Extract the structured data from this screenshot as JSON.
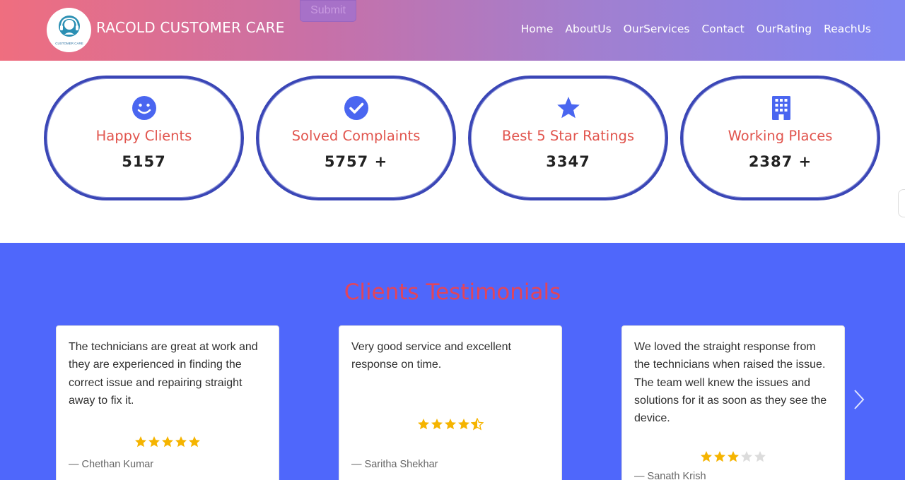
{
  "header": {
    "brand": "RACOLD CUSTOMER CARE",
    "logo_caption": "CUSTOMER CARE",
    "submit_label": "Submit",
    "nav": [
      "Home",
      "AboutUs",
      "OurServices",
      "Contact",
      "OurRating",
      "ReachUs"
    ]
  },
  "stats": [
    {
      "icon": "smile-icon",
      "label": "Happy Clients",
      "value": "5157"
    },
    {
      "icon": "check-circle-icon",
      "label": "Solved Complaints",
      "value": "5757 +"
    },
    {
      "icon": "star-icon",
      "label": "Best 5 Star Ratings",
      "value": "3347"
    },
    {
      "icon": "building-icon",
      "label": "Working Places",
      "value": "2387 +"
    }
  ],
  "testimonials": {
    "title": "Clients Testimonials",
    "items": [
      {
        "quote": "The technicians are great at work and they are experienced in finding the correct issue and repairing straight away to fix it.",
        "rating": 5,
        "author": "— Chethan Kumar"
      },
      {
        "quote": "Very good service and excellent response on time.",
        "rating": 4.5,
        "author": "— Saritha Shekhar"
      },
      {
        "quote": "We loved the straight response from the technicians when raised the issue. The team well knew the issues and solutions for it as soon as they see the device.",
        "rating": 3,
        "author": "— Sanath Krish"
      }
    ]
  },
  "colors": {
    "accent_blue": "#4f67fb",
    "ring_blue": "#3a46b6",
    "label_red": "#e1554e",
    "title_red": "#e2455a",
    "star_gold": "#f5b400",
    "icon_blue": "#4a66f0"
  }
}
